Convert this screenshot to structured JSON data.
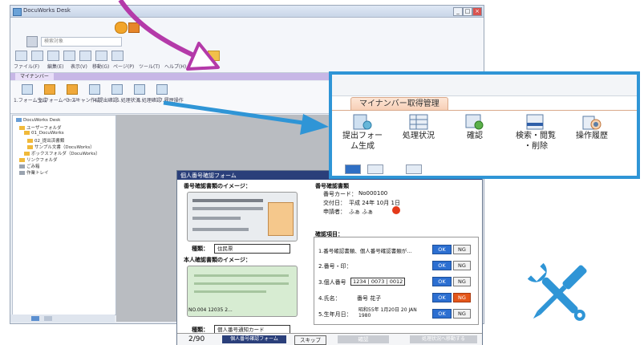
{
  "window": {
    "title": "DocuWorks Desk",
    "title_controls": [
      "_",
      "□",
      "×"
    ]
  },
  "ribbon": {
    "search_placeholder": "検索対象",
    "labels": [
      "ファイル(F)",
      "編集(E)",
      "表示(V)",
      "移動(G)",
      "ページ(P)",
      "ツール(T)",
      "ヘルプ(H)"
    ]
  },
  "my_number_tab": "マイナンバー",
  "mtool_labels": [
    "1.フォーム生成",
    "2.フォームページ",
    "3.スキャン作成",
    "4.提出確認",
    "5.処理状況",
    "6.処理確認",
    "7.履歴操作"
  ],
  "tree": {
    "items": [
      "DocuWorks Desk",
      "ユーザーフォルダ",
      "01_DocuWorks",
      "02_提出済書類",
      "サンプル文書（DocuWorks）",
      "ボックスフォルダ（DocuWorks）",
      "リンクフォルダ",
      "ごみ箱",
      "作業トレイ"
    ]
  },
  "form": {
    "header": "個人番号確認フォーム",
    "card1_title": "番号確認書類のイメージ：",
    "card2_title": "本人確認書類のイメージ：",
    "number_section": "番号確認書類",
    "number_fields": [
      {
        "label": "番号カード：",
        "value": "No000100"
      },
      {
        "label": "交付日：",
        "value": "平成 24年 10月 1日"
      },
      {
        "label": "申請者：",
        "value": "ふぁ ふぁ"
      }
    ],
    "check_section": "確認項目：",
    "checks": [
      {
        "label": "1.番号確認書類、個人番号確認書類が…",
        "value": ""
      },
      {
        "label": "2.番号・印：",
        "value": ""
      },
      {
        "label": "3.個人番号",
        "value": "1234 | 0073 | 0012"
      },
      {
        "label": "4.氏名：",
        "value": "番号 花子"
      },
      {
        "label": "5.生年月日：",
        "value": "昭和55年 1月20日 20 JAN 1980"
      }
    ],
    "ok_label": "OK",
    "ng_label": "NG",
    "card1_type_label": "種類：",
    "card1_type_value": "住民票",
    "card2_type_label": "種類：",
    "card2_type_value": "個人番号通知カード",
    "card2_number": "NO.004 12035 2...",
    "page_counter": "2/90",
    "footer_buttons": [
      "個人番号確認フォーム",
      "スキップ",
      "確認",
      "処理状況へ移動する"
    ]
  },
  "callout": {
    "tab_label": "マイナンバー取得管理",
    "items": [
      {
        "label": "提出フォー\nム生成",
        "icon": "form-generate-icon"
      },
      {
        "label": "処理状況",
        "icon": "status-table-icon"
      },
      {
        "label": "確認",
        "icon": "confirm-check-icon"
      },
      {
        "label": "検索・閲覧\n・削除",
        "icon": "search-view-delete-icon"
      },
      {
        "label": "操作履歴",
        "icon": "operation-history-icon"
      }
    ]
  },
  "colors": {
    "callout_border": "#2f95d6",
    "arrow_magenta": "#b43aa9",
    "arrow_blue": "#2f95d6",
    "tools_icon": "#2f95d6",
    "ok_button": "#2c6fd1",
    "ng_red": "#e43a1a"
  }
}
